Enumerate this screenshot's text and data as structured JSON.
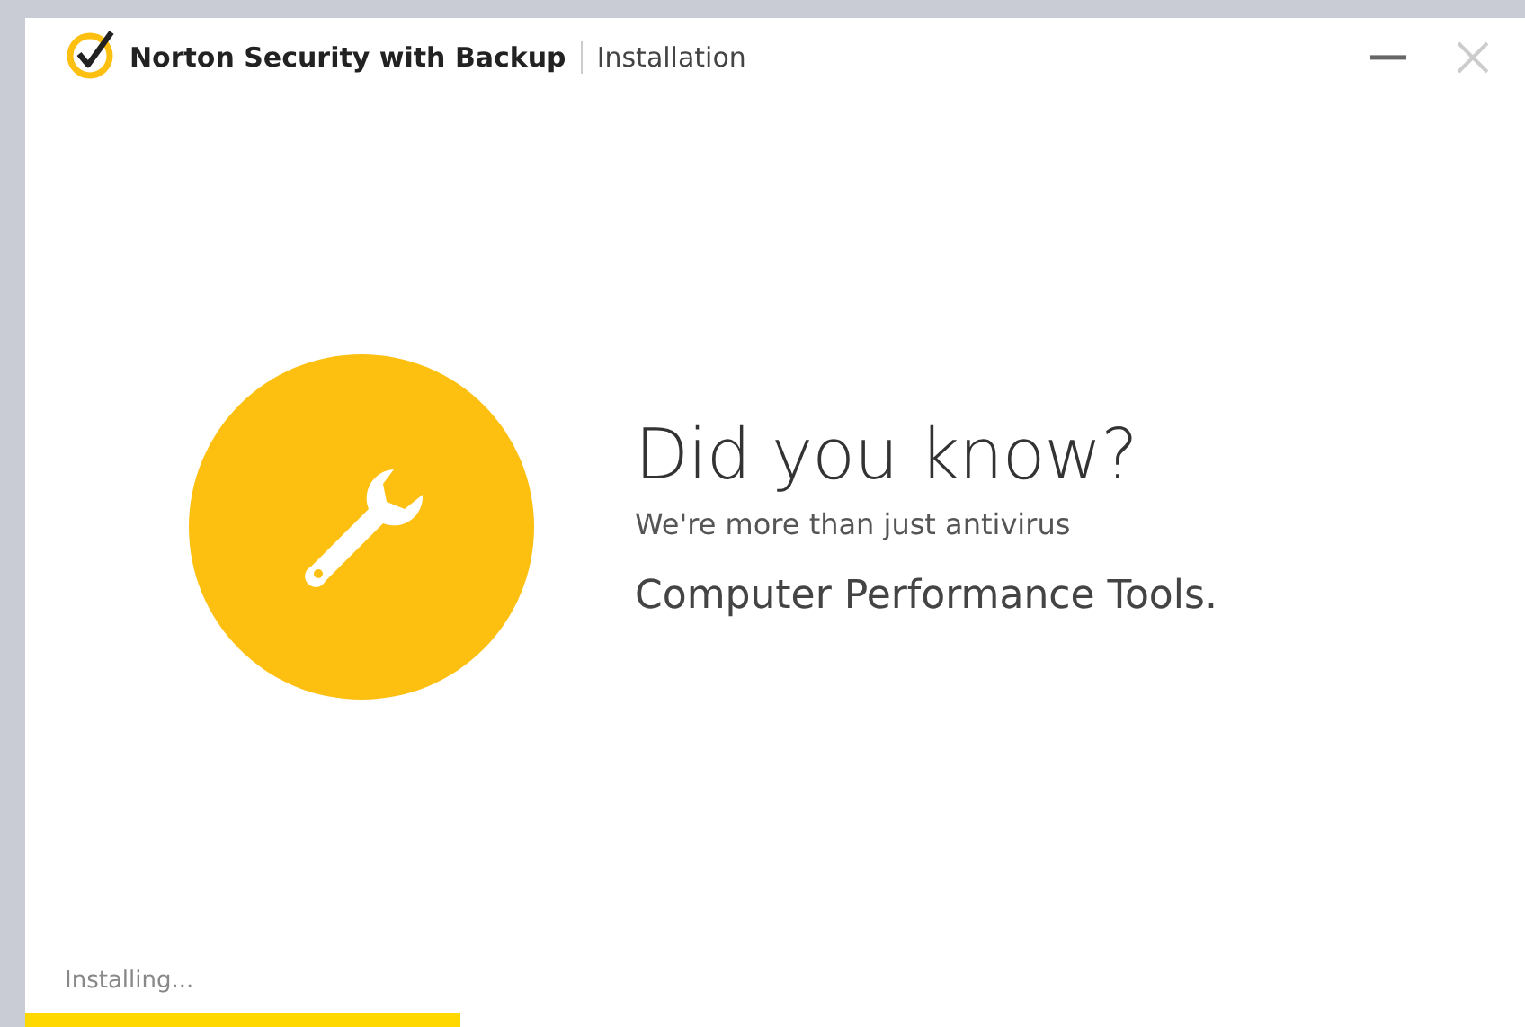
{
  "window": {
    "brand": "Norton Security with Backup",
    "title": "Installation"
  },
  "slide": {
    "heading": "Did you know?",
    "subtitle": "We're more than just antivirus",
    "feature": "Computer Performance Tools."
  },
  "status": {
    "text": "Installing...",
    "level": 0.29
  }
}
